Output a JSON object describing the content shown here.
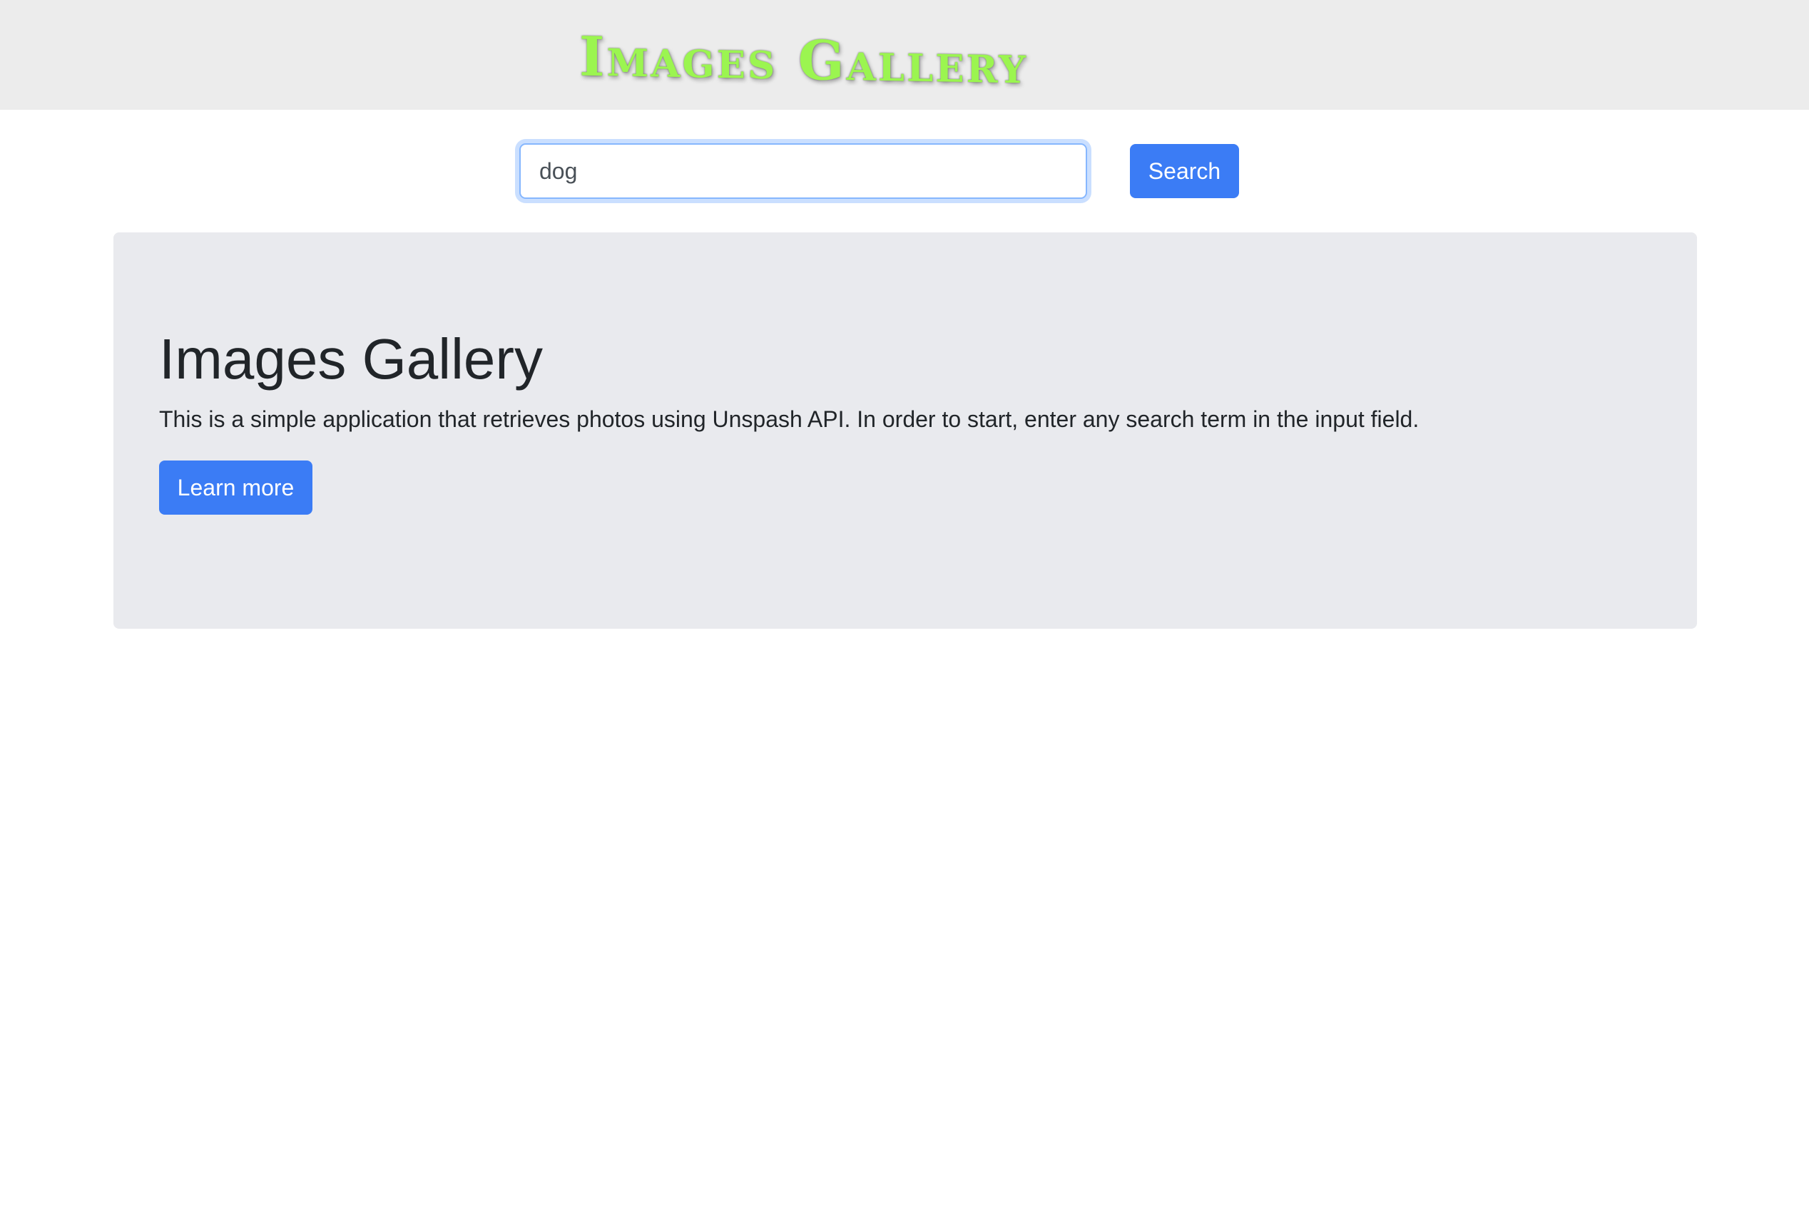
{
  "header": {
    "logo_text": "Images Gallery",
    "logo_color": "#9bf550"
  },
  "search": {
    "value": "dog",
    "button_label": "Search"
  },
  "jumbotron": {
    "title": "Images Gallery",
    "description": "This is a simple application that retrieves photos using Unspash API. In order to start, enter any search term in the input field.",
    "button_label": "Learn more"
  },
  "colors": {
    "primary": "#3b7cf5",
    "header_bg": "#ececec",
    "jumbotron_bg": "#e9eaee"
  }
}
